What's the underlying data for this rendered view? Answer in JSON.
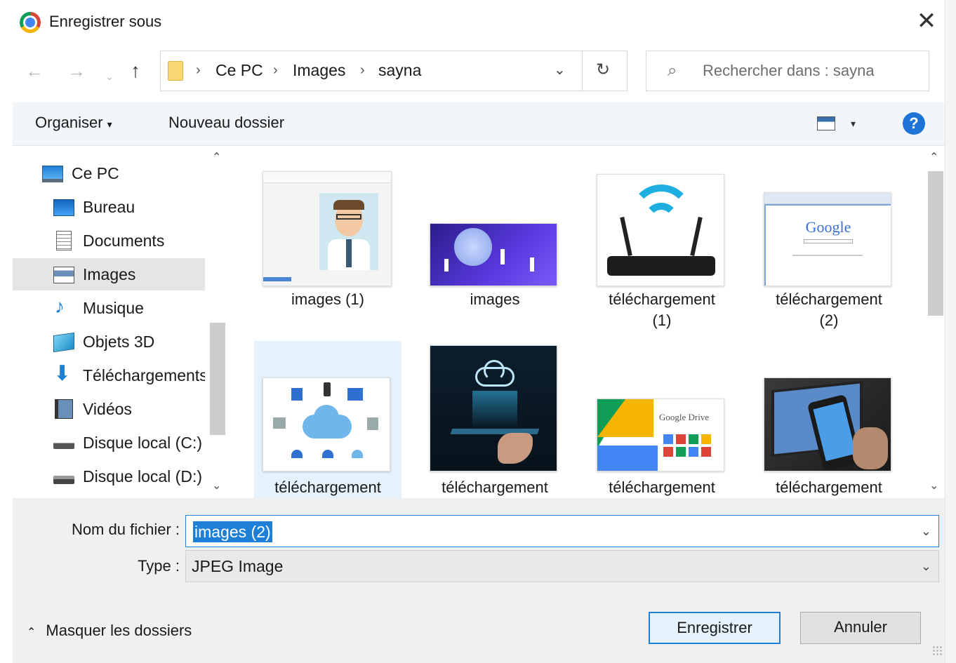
{
  "window": {
    "title": "Enregistrer sous",
    "close_glyph": "✕"
  },
  "nav": {
    "back_glyph": "←",
    "forward_glyph": "→",
    "recent_glyph": "⌄",
    "up_glyph": "↑",
    "breadcrumb": [
      "Ce PC",
      "Images",
      "sayna"
    ],
    "separator": "›",
    "dropdown_glyph": "⌄",
    "refresh_glyph": "↻"
  },
  "search": {
    "placeholder": "Rechercher dans : sayna",
    "icon_glyph": "⌕"
  },
  "toolbar": {
    "organize_label": "Organiser",
    "organize_caret": "▾",
    "new_folder_label": "Nouveau dossier",
    "view_caret": "▾",
    "help_glyph": "?"
  },
  "sidebar": {
    "items": [
      {
        "label": "Ce PC",
        "icon": "pc-icon"
      },
      {
        "label": "Bureau",
        "icon": "desktop-icon"
      },
      {
        "label": "Documents",
        "icon": "documents-icon"
      },
      {
        "label": "Images",
        "icon": "images-icon",
        "selected": true
      },
      {
        "label": "Musique",
        "icon": "music-icon"
      },
      {
        "label": "Objets 3D",
        "icon": "objects-3d-icon"
      },
      {
        "label": "Téléchargements",
        "icon": "downloads-icon"
      },
      {
        "label": "Vidéos",
        "icon": "videos-icon"
      },
      {
        "label": "Disque local (C:)",
        "icon": "disk-c-icon"
      },
      {
        "label": "Disque local (D:)",
        "icon": "disk-d-icon"
      }
    ],
    "music_glyph": "♪",
    "download_glyph": "⬇",
    "scroll_up_glyph": "⌃",
    "scroll_down_glyph": "⌄"
  },
  "files": {
    "items": [
      {
        "label": "images (1)",
        "thumb": "cartoon-man"
      },
      {
        "label": "images",
        "thumb": "isometric-blue"
      },
      {
        "label": "téléchargement (1)",
        "label_line1": "téléchargement",
        "label_line2": "(1)",
        "thumb": "wifi-router"
      },
      {
        "label": "téléchargement (2)",
        "label_line1": "téléchargement",
        "label_line2": "(2)",
        "thumb": "google-search"
      },
      {
        "label": "téléchargement",
        "thumb": "cloud-diagram",
        "selected": true
      },
      {
        "label": "téléchargement",
        "thumb": "cloud-hand"
      },
      {
        "label": "téléchargement",
        "thumb": "google-drive"
      },
      {
        "label": "téléchargement",
        "thumb": "dropbox-phone"
      }
    ],
    "google_text": "Google",
    "google_drive_text": "Google Drive",
    "scroll_up_glyph": "⌃",
    "scroll_down_glyph": "⌄"
  },
  "form": {
    "filename_label": "Nom du fichier :",
    "filename_value": "images (2)",
    "type_label": "Type :",
    "type_value": "JPEG Image",
    "caret_glyph": "⌄"
  },
  "footer": {
    "hide_folders_label": "Masquer les dossiers",
    "hide_caret": "⌃",
    "save_label": "Enregistrer",
    "cancel_label": "Annuler"
  },
  "colors": {
    "accent": "#1e7fd6",
    "selection_bg": "#e5f1fb",
    "sidebar_selected": "#e5e5e5"
  }
}
